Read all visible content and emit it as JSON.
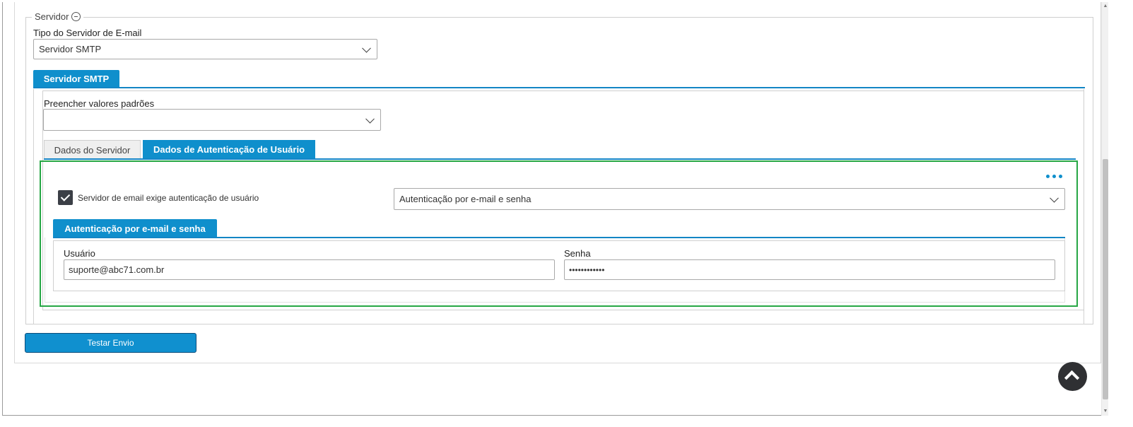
{
  "server": {
    "legend": "Servidor",
    "type_label": "Tipo do Servidor de E-mail",
    "type_value": "Servidor SMTP"
  },
  "smtp": {
    "section_tab": "Servidor SMTP",
    "defaults_label": "Preencher valores padrões",
    "defaults_value": "",
    "tabs": [
      {
        "label": "Dados do Servidor",
        "active": false
      },
      {
        "label": "Dados de Autenticação de Usuário",
        "active": true
      }
    ]
  },
  "auth": {
    "requires_auth_label": "Servidor de email exige autenticação de usuário",
    "requires_auth_checked": true,
    "method_value": "Autenticação por e-mail e senha",
    "method_tab": "Autenticação por e-mail e senha",
    "user_label": "Usuário",
    "user_value": "suporte@abc71.com.br",
    "password_label": "Senha",
    "password_value": "••••••••••••"
  },
  "actions": {
    "test_send": "Testar Envio"
  },
  "colors": {
    "accent": "#0f8fcc",
    "highlight": "#27a745",
    "checkbox": "#3b3f46"
  }
}
